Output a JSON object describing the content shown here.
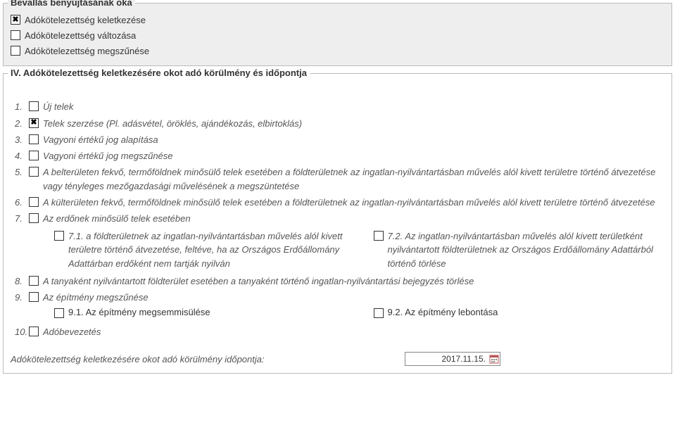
{
  "reason": {
    "legend": "Bevallás benyújtásának oka",
    "items": [
      {
        "label": "Adókötelezettség keletkezése",
        "checked": true
      },
      {
        "label": "Adókötelezettség változása",
        "checked": false
      },
      {
        "label": "Adókötelezettség megszűnése",
        "checked": false
      }
    ]
  },
  "section4": {
    "legend": "IV. Adókötelezettség keletkezésére okot adó körülmény és időpontja",
    "items": {
      "i1": {
        "num": "1.",
        "label": "Új telek"
      },
      "i2": {
        "num": "2.",
        "label": "Telek szerzése (Pl. adásvétel, öröklés, ajándékozás, elbirtoklás)",
        "checked": true
      },
      "i3": {
        "num": "3.",
        "label": "Vagyoni értékű jog alapítása"
      },
      "i4": {
        "num": "4.",
        "label": "Vagyoni értékű jog megszűnése"
      },
      "i5": {
        "num": "5.",
        "label": "A belterületen fekvő, termőföldnek minősülő telek esetében a földterületnek az ingatlan-nyilvántartásban művelés alól kivett területre történő átvezetése vagy tényleges mezőgazdasági művelésének a megszüntetése"
      },
      "i6": {
        "num": "6.",
        "label": "A külterületen fekvő, termőföldnek minősülő telek esetében a földterületnek az ingatlan-nyilvántartásban művelés alól kivett területre történő átvezetése"
      },
      "i7": {
        "num": "7.",
        "label": "Az erdőnek minősülő telek esetében"
      },
      "i7_1": {
        "label": "7.1. a földterületnek az ingatlan-nyilvántartásban művelés alól kivett területre történő átvezetése, feltéve, ha az Országos Erdőállomány Adattárban erdőként nem tartják nyilván"
      },
      "i7_2": {
        "label": "7.2. Az ingatlan-nyilvántartásban művelés alól kivett területként nyilvántartott földterületnek az Országos Erdőállomány Adattárból történő törlése"
      },
      "i8": {
        "num": "8.",
        "label": "A tanyaként nyilvántartott földterület esetében a tanyaként történő ingatlan-nyilvántartási bejegyzés törlése"
      },
      "i9": {
        "num": "9.",
        "label": "Az építmény megszűnése"
      },
      "i9_1": {
        "label": "9.1. Az építmény megsemmisülése"
      },
      "i9_2": {
        "label": "9.2. Az építmény lebontása"
      },
      "i10": {
        "num": "10.",
        "label": "Adóbevezetés"
      }
    },
    "date_label": "Adókötelezettség keletkezésére okot adó körülmény időpontja:",
    "date_value": "2017.11.15."
  }
}
